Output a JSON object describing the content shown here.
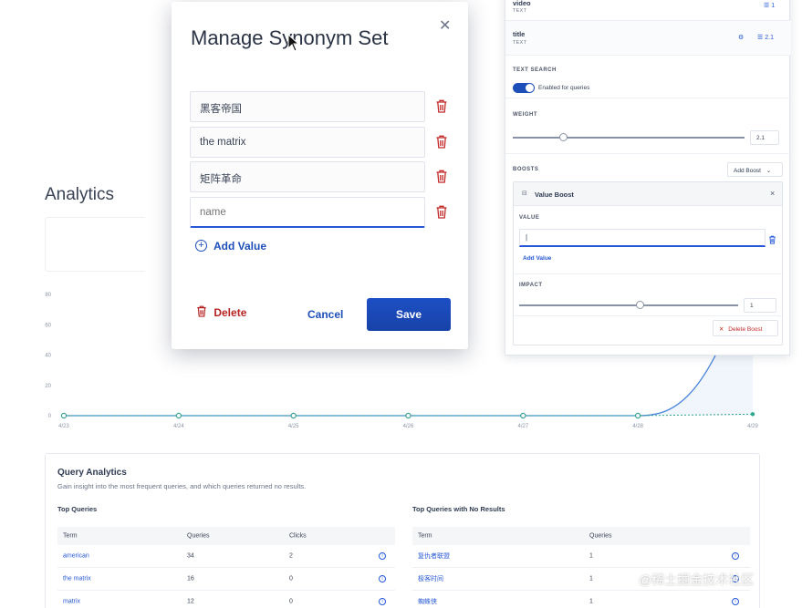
{
  "analytics": {
    "title": "Analytics"
  },
  "chart_data": {
    "type": "line",
    "x": [
      "4/23",
      "4/24",
      "4/25",
      "4/26",
      "4/27",
      "4/28",
      "4/29"
    ],
    "series": [
      {
        "values": [
          0,
          0,
          0,
          0,
          0,
          0,
          100
        ]
      },
      {
        "values": [
          0,
          0,
          0,
          0,
          0,
          0,
          1
        ]
      }
    ],
    "yticks": [
      "0",
      "20",
      "40",
      "60",
      "80"
    ],
    "ylim": [
      0,
      80
    ],
    "grid": false,
    "colors": {
      "primary": "#4a86d9",
      "secondary": "#2fa890",
      "dot": "#3aa394"
    }
  },
  "query_analytics": {
    "title": "Query Analytics",
    "subtitle": "Gain insight into the most frequent queries, and which queries returned no results.",
    "top_queries": {
      "heading": "Top Queries",
      "columns": [
        "Term",
        "Queries",
        "Clicks"
      ],
      "rows": [
        {
          "term": "american",
          "queries": "34",
          "clicks": "2"
        },
        {
          "term": "the matrix",
          "queries": "16",
          "clicks": "0"
        },
        {
          "term": "matrix",
          "queries": "12",
          "clicks": "0"
        }
      ]
    },
    "no_results": {
      "heading": "Top Queries with No Results",
      "columns": [
        "Term",
        "Queries"
      ],
      "rows": [
        {
          "term": "复仇者联盟",
          "queries": "1"
        },
        {
          "term": "极客时间",
          "queries": "1"
        },
        {
          "term": "蜘蛛侠",
          "queries": "1"
        }
      ]
    }
  },
  "side_panel": {
    "video": {
      "name": "video",
      "type": "TEXT",
      "weight": "1"
    },
    "title": {
      "name": "title",
      "type": "TEXT",
      "weight": "2.1"
    },
    "text_search": {
      "label": "TEXT SEARCH",
      "toggle_label": "Enabled for queries"
    },
    "weight": {
      "label": "WEIGHT",
      "value": "2.1",
      "level": 0.22
    },
    "boosts": {
      "label": "BOOSTS",
      "add_label": "Add Boost"
    },
    "value_boost": {
      "title": "Value Boost",
      "value_label": "VALUE",
      "value": "|",
      "add_value": "Add Value",
      "impact_label": "IMPACT",
      "impact": "1",
      "impact_level": 0.55,
      "delete_label": "Delete Boost"
    }
  },
  "modal": {
    "title": "Manage Synonym Set",
    "synonyms": [
      "黑客帝国",
      "the matrix",
      "矩阵革命"
    ],
    "new_placeholder": "name",
    "add_value": "Add Value",
    "delete": "Delete",
    "cancel": "Cancel",
    "save": "Save"
  },
  "watermark": "@稀土掘金技术社区"
}
